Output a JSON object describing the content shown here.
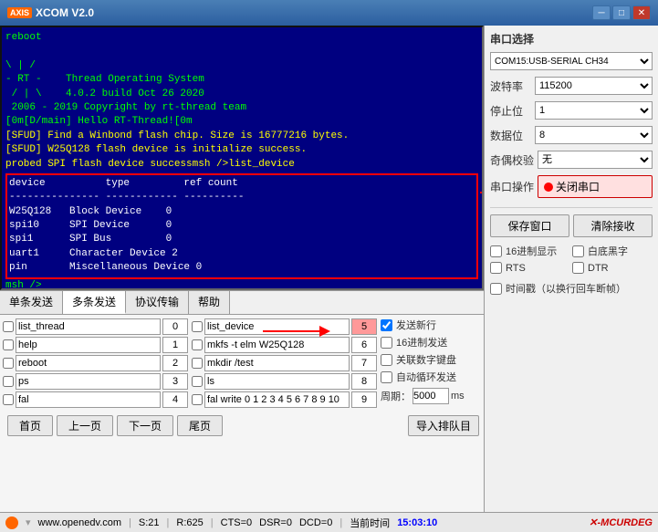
{
  "titleBar": {
    "logo": "AXIS",
    "title": "XCOM V2.0",
    "minimizeLabel": "─",
    "maximizeLabel": "□",
    "closeLabel": "✕"
  },
  "terminal": {
    "lines": [
      {
        "text": "reboot",
        "color": "green"
      },
      {
        "text": "",
        "color": "green"
      },
      {
        "text": "\\ | /",
        "color": "green"
      },
      {
        "text": "- RT -    Thread Operating System",
        "color": "green"
      },
      {
        "text": " / | \\    4.0.2 build Oct 26 2020",
        "color": "green"
      },
      {
        "text": " 2006 - 2019 Copyright by rt-thread team",
        "color": "green"
      },
      {
        "text": "[0m[D/main] Hello RT-Thread![0m",
        "color": "green"
      },
      {
        "text": "[SFUD] Find a Winbond flash chip. Size is 16777216 bytes.",
        "color": "yellow"
      },
      {
        "text": "[SFUD] W25Q128 flash device is initialize success.",
        "color": "yellow"
      },
      {
        "text": "probed SPI flash device successmsh />list_device",
        "color": "yellow"
      },
      {
        "text": "device          type         ref count",
        "color": "white"
      },
      {
        "text": "--------------- ------------ ----------",
        "color": "white"
      },
      {
        "text": "W25Q128   Block Device    0",
        "color": "white"
      },
      {
        "text": "spi10     SPI Device      0",
        "color": "white"
      },
      {
        "text": "spi1      SPI Bus         0",
        "color": "white"
      },
      {
        "text": "uart1     Character Device 2",
        "color": "white"
      },
      {
        "text": "pin       Miscellaneous Device 0",
        "color": "white"
      },
      {
        "text": "msh />",
        "color": "green"
      },
      {
        "text": "msh />",
        "color": "green"
      }
    ]
  },
  "tabs": [
    {
      "label": "单条发送",
      "active": false
    },
    {
      "label": "多条发送",
      "active": true
    },
    {
      "label": "协议传输",
      "active": false
    },
    {
      "label": "帮助",
      "active": false
    }
  ],
  "multiSend": {
    "leftColumn": {
      "rows": [
        {
          "checked": false,
          "text": "list_thread",
          "num": "0"
        },
        {
          "checked": false,
          "text": "help",
          "num": "1"
        },
        {
          "checked": false,
          "text": "reboot",
          "num": "2"
        },
        {
          "checked": false,
          "text": "ps",
          "num": "3"
        },
        {
          "checked": false,
          "text": "fal",
          "num": "4"
        }
      ]
    },
    "rightColumn": {
      "rows": [
        {
          "checked": false,
          "text": "list_device",
          "num": "5"
        },
        {
          "checked": false,
          "text": "mkfs -t elm W25Q128",
          "num": "6"
        },
        {
          "checked": false,
          "text": "mkdir /test",
          "num": "7"
        },
        {
          "checked": false,
          "text": "ls",
          "num": "8"
        },
        {
          "checked": false,
          "text": "fal write 0 1 2 3 4 5 6 7 8 9 10",
          "num": "9"
        }
      ]
    },
    "rightChecks": [
      {
        "checked": true,
        "label": "发送新行"
      },
      {
        "checked": false,
        "label": "16进制发送"
      },
      {
        "checked": false,
        "label": "关联数字键盘"
      },
      {
        "checked": false,
        "label": "自动循环发送"
      },
      {
        "label": "周期：",
        "value": "5000",
        "unit": "ms"
      }
    ]
  },
  "pageNav": {
    "buttons": [
      "首页",
      "上一页",
      "下一页",
      "尾页"
    ]
  },
  "importBtn": "导入排队目",
  "rightPanel": {
    "serialLabel": "串口选择",
    "portValue": "COM15:USB-SERIAL CH34",
    "baudLabel": "波特率",
    "baudValue": "115200",
    "stopLabel": "停止位",
    "stopValue": "1",
    "dataLabel": "数据位",
    "dataValue": "8",
    "parityLabel": "奇偶校验",
    "parityValue": "无",
    "portOpLabel": "串口操作",
    "closePortLabel": "关闭串口",
    "saveWindowLabel": "保存窗口",
    "clearRecvLabel": "清除接收",
    "checkboxes": [
      {
        "checked": false,
        "label": "16进制显示"
      },
      {
        "checked": false,
        "label": "白底黑字"
      },
      {
        "checked": false,
        "label": "RTS"
      },
      {
        "checked": false,
        "label": "DTR"
      },
      {
        "checked": false,
        "label": "时间戳（以换行回车断帧）"
      }
    ]
  },
  "statusBar": {
    "url": "www.openedv.com",
    "s": "S:21",
    "r": "R:625",
    "cts": "CTS=0",
    "dsr": "DSR=0",
    "dcd": "DCD=0",
    "timeLabel": "当前时间",
    "time": "15:03:10",
    "brand": "MCURDEG"
  }
}
